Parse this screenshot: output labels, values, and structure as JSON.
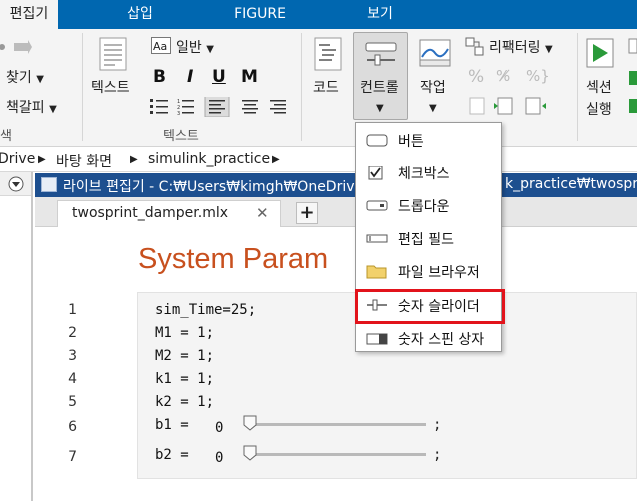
{
  "ribbon_tabs": [
    {
      "label": "편집기",
      "active": true
    },
    {
      "label": "삽입",
      "active": false
    },
    {
      "label": "FIGURE",
      "active": false
    },
    {
      "label": "보기",
      "active": false
    }
  ],
  "ribbon": {
    "find": "찾기",
    "bookmark": "책갈피",
    "partial_group_label": "색",
    "text_button": "텍스트",
    "style_dropdown": "일반",
    "bold": "B",
    "italic": "I",
    "underline": "U",
    "monospace": "M",
    "text_group_label": "텍스트",
    "code_button": "코드",
    "control_button": "컨트롤",
    "task_button": "작업",
    "refactor_button": "리팩터링",
    "section_run_line1": "섹션",
    "section_run_line2": "실행"
  },
  "breadcrumb": [
    "Drive",
    "바탕 화면",
    "simulink_practice"
  ],
  "window": {
    "title": "라이브 편집기 - C:₩Users₩kimgh₩OneDriv",
    "title_tail": "k_practice₩twosprin"
  },
  "file_tab": {
    "name": "twosprint_damper.mlx",
    "close": "✕",
    "add": "+"
  },
  "editor": {
    "section_title": "System Param",
    "lines": [
      {
        "num": "1",
        "code": "sim_Time=25;"
      },
      {
        "num": "2",
        "code": "M1 = 1;"
      },
      {
        "num": "3",
        "code": "M2 = 1;"
      },
      {
        "num": "4",
        "code": "k1 = 1;"
      },
      {
        "num": "5",
        "code": "k2 = 1;"
      }
    ],
    "sliders": [
      {
        "num": "6",
        "label": "b1 =",
        "value": "0",
        "semicolon": ";"
      },
      {
        "num": "7",
        "label": "b2 =",
        "value": "0",
        "semicolon": ";"
      }
    ]
  },
  "control_menu": {
    "items": [
      {
        "label": "버튼",
        "icon": "button-icon"
      },
      {
        "label": "체크박스",
        "icon": "checkbox-icon"
      },
      {
        "label": "드롭다운",
        "icon": "dropdown-icon"
      },
      {
        "label": "편집 필드",
        "icon": "edit-field-icon"
      },
      {
        "label": "파일 브라우저",
        "icon": "folder-icon"
      },
      {
        "label": "숫자 슬라이더",
        "icon": "slider-icon"
      },
      {
        "label": "숫자 스핀 상자",
        "icon": "spinner-icon"
      }
    ],
    "highlighted_index": 5,
    "highlight_color": "#e2131b"
  },
  "colors": {
    "tab_bar": "#0067b0",
    "title_bar": "#1d4f8f",
    "section_title": "#c8501e"
  }
}
